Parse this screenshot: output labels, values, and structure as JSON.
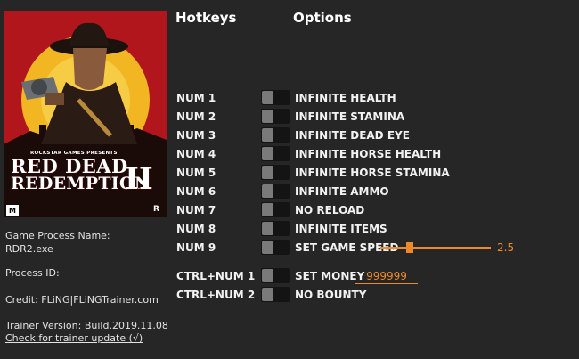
{
  "cover": {
    "publisher": "ROCKSTAR GAMES PRESENTS",
    "title_line1": "RED DEAD",
    "title_line2": "REDEMPTION",
    "roman_numeral": "II",
    "rating": "M",
    "corner_logo": "R"
  },
  "info": {
    "process_label": "Game Process Name:",
    "process_value": "RDR2.exe",
    "process_id_label": "Process ID:",
    "credit": "Credit: FLiNG|FLiNGTrainer.com",
    "version": "Trainer Version: Build.2019.11.08",
    "update_link": "Check for trainer update (√)"
  },
  "headers": {
    "hotkeys": "Hotkeys",
    "options": "Options"
  },
  "cheats": [
    {
      "key": "NUM 1",
      "label": "INFINITE HEALTH"
    },
    {
      "key": "NUM 2",
      "label": "INFINITE STAMINA"
    },
    {
      "key": "NUM 3",
      "label": "INFINITE DEAD EYE"
    },
    {
      "key": "NUM 4",
      "label": "INFINITE HORSE HEALTH"
    },
    {
      "key": "NUM 5",
      "label": "INFINITE HORSE STAMINA"
    },
    {
      "key": "NUM 6",
      "label": "INFINITE AMMO"
    },
    {
      "key": "NUM 7",
      "label": "NO RELOAD"
    },
    {
      "key": "NUM 8",
      "label": "INFINITE ITEMS"
    },
    {
      "key": "NUM 9",
      "label": "SET GAME SPEED",
      "value": "2.5",
      "slider_fraction": 0.27
    },
    {
      "key": "CTRL+NUM 1",
      "label": "SET MONEY",
      "value": "999999"
    },
    {
      "key": "CTRL+NUM 2",
      "label": "NO BOUNTY"
    }
  ],
  "colors": {
    "accent": "#ec8a2b",
    "background": "#262626",
    "cover_red": "#b0161b",
    "cover_yellow": "#f2b622"
  }
}
